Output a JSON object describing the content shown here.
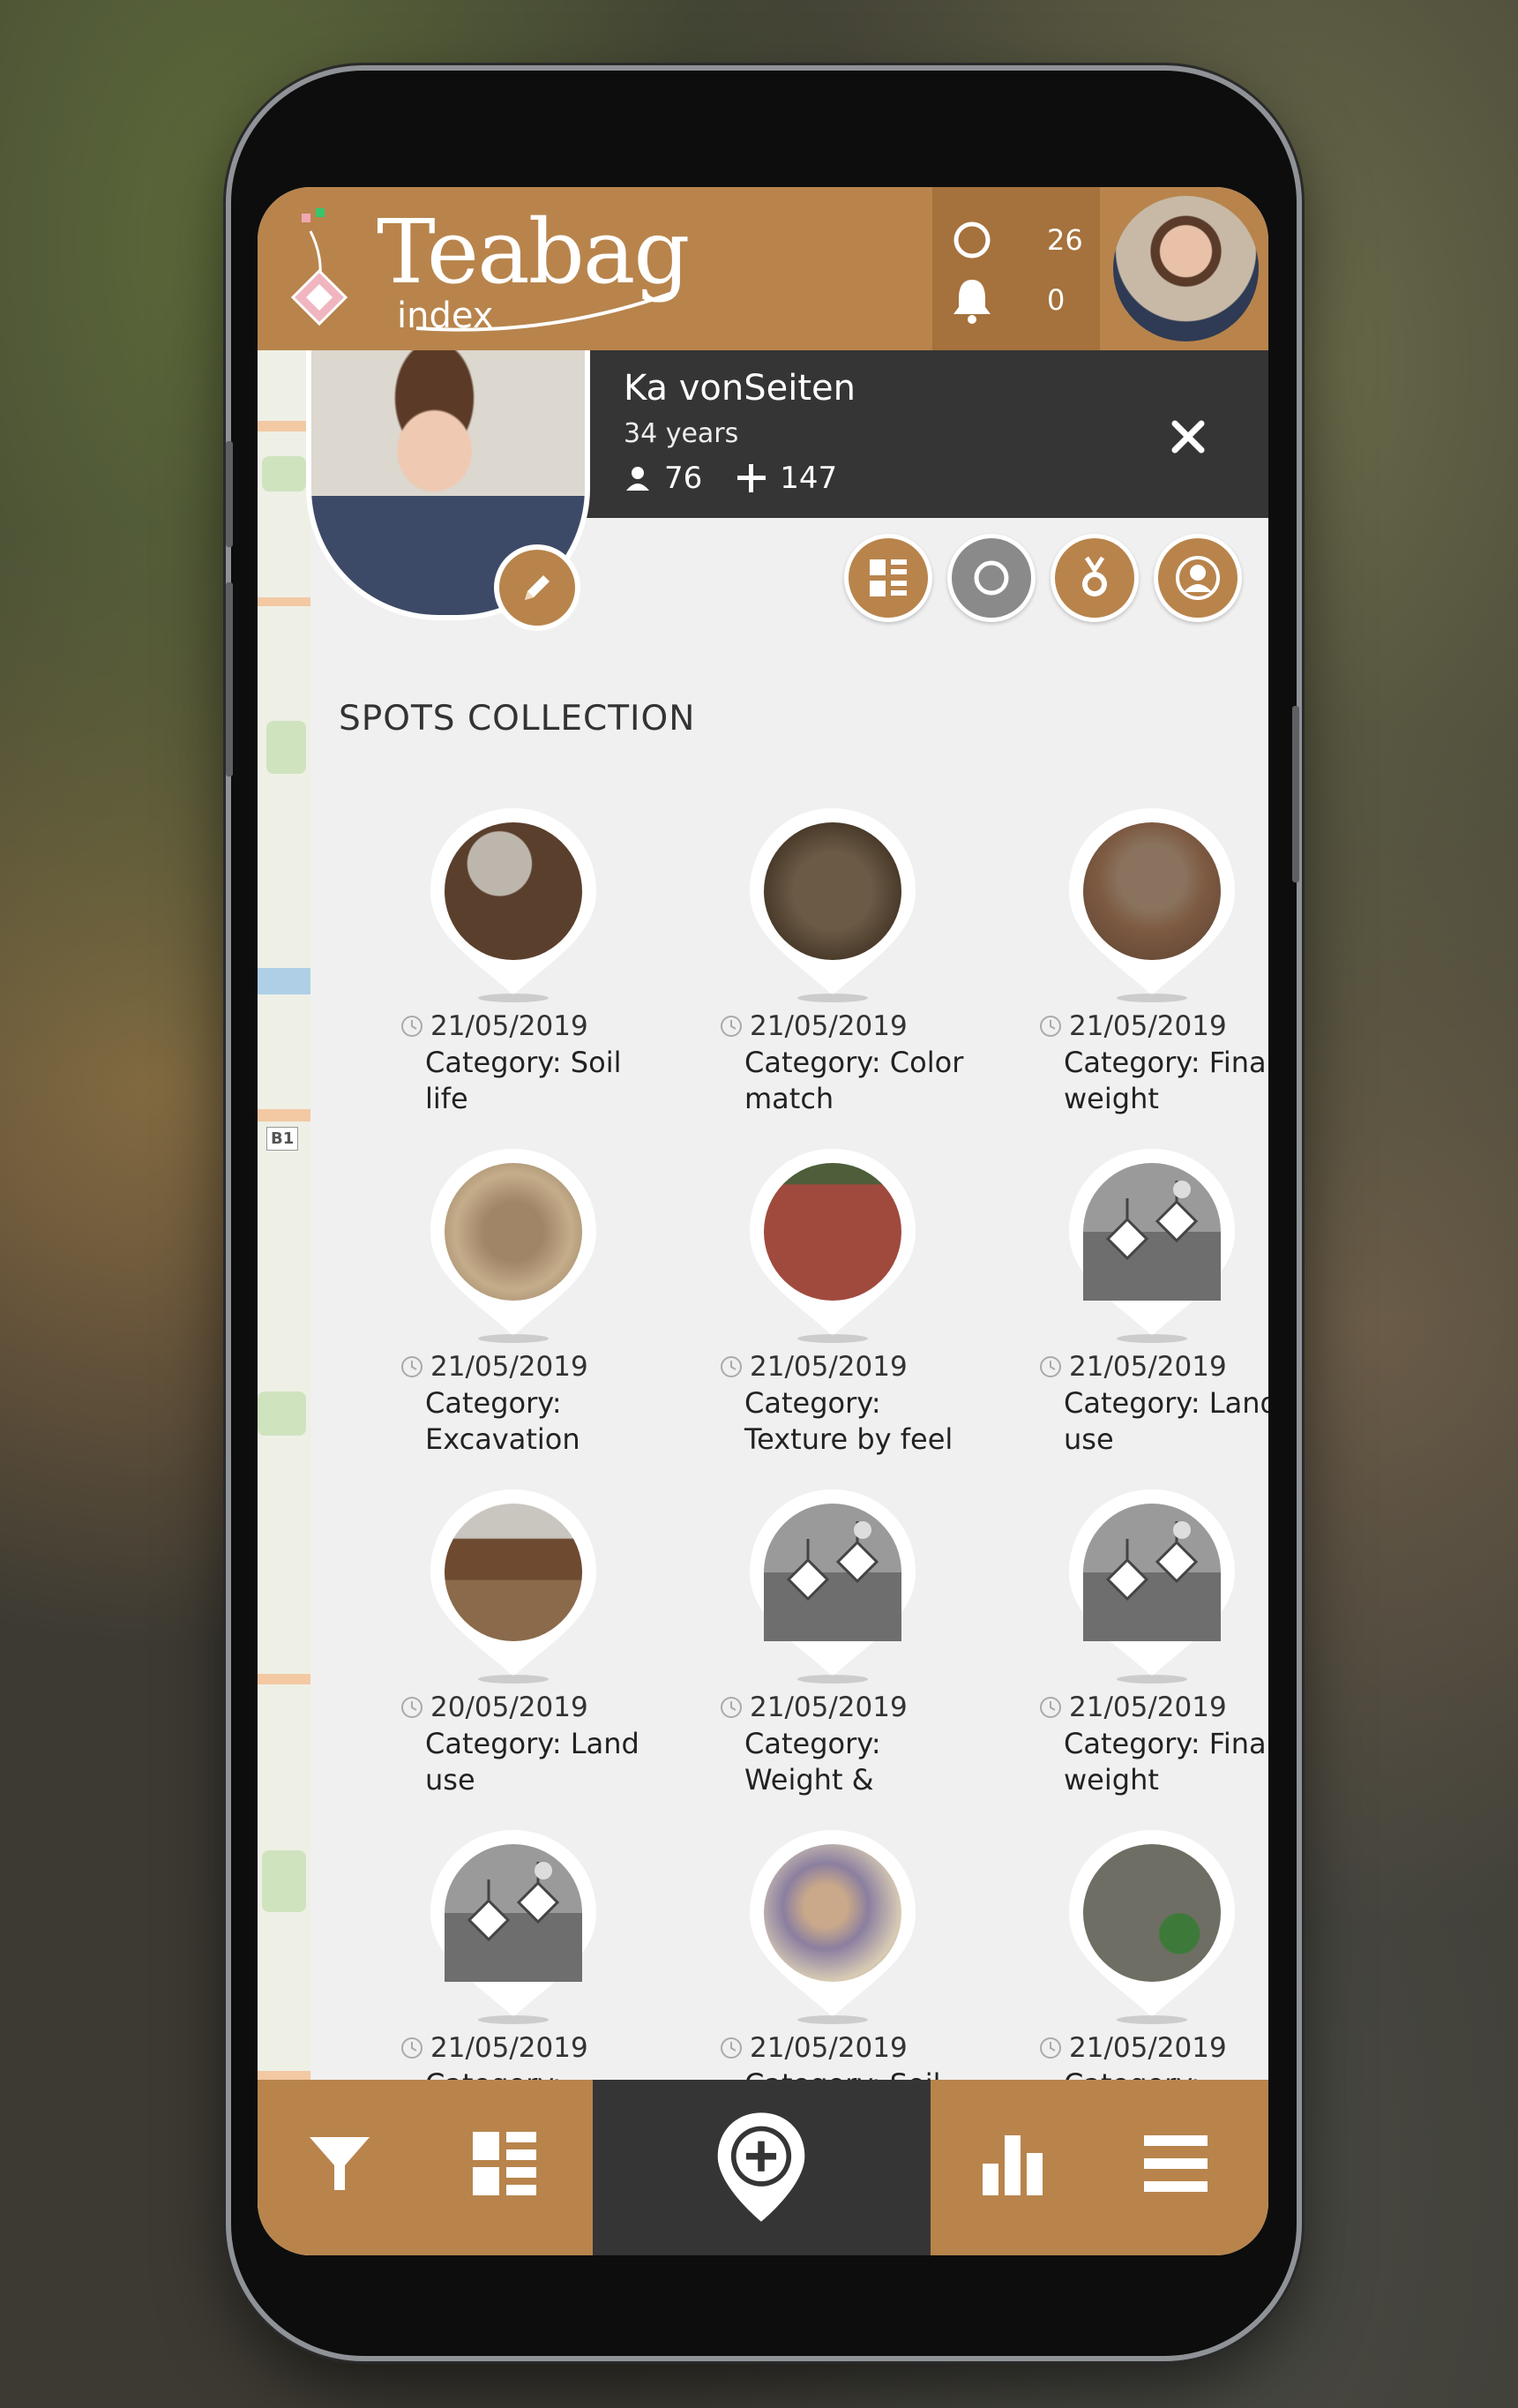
{
  "header": {
    "logo_main": "Teabag",
    "logo_sub": "index",
    "teabag_count": "26",
    "notification_count": "0"
  },
  "profile": {
    "name": "Ka vonSeiten",
    "age": "34 years",
    "followers": "76",
    "following": "147"
  },
  "section_title": "SPOTS COLLECTION",
  "map_label": "B1",
  "spots": [
    {
      "date": "21/05/2019",
      "category": "Category: Soil life",
      "thumb": "soil-dark"
    },
    {
      "date": "21/05/2019",
      "category": "Category: Color match",
      "thumb": "soil-brown"
    },
    {
      "date": "21/05/2019",
      "category": "Category: Final weight",
      "thumb": "soil-grass"
    },
    {
      "date": "21/05/2019",
      "category": "Category: Excavation",
      "thumb": "soil-light"
    },
    {
      "date": "21/05/2019",
      "category": "Category: Texture by feel",
      "thumb": "soil-red"
    },
    {
      "date": "21/05/2019",
      "category": "Category: Land use",
      "thumb": "teabag-placeholder"
    },
    {
      "date": "20/05/2019",
      "category": "Category: Land use",
      "thumb": "soil-profile"
    },
    {
      "date": "21/05/2019",
      "category": "Category: Weight &",
      "thumb": "teabag-placeholder"
    },
    {
      "date": "21/05/2019",
      "category": "Category: Final weight",
      "thumb": "teabag-placeholder"
    },
    {
      "date": "21/05/2019",
      "category": "Category:",
      "thumb": "teabag-placeholder"
    },
    {
      "date": "21/05/2019",
      "category": "Category: Soil",
      "thumb": "drawing"
    },
    {
      "date": "21/05/2019",
      "category": "Category:",
      "thumb": "color-chart"
    }
  ],
  "colors": {
    "brand": "#b8844c",
    "brand_dark": "#a5713c",
    "dark_bar": "#353535",
    "grey_button": "#8a8a8a"
  }
}
